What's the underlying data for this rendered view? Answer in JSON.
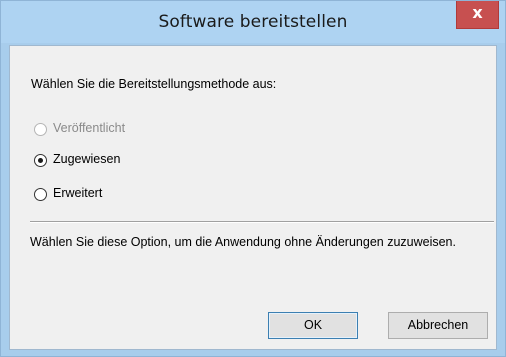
{
  "window": {
    "title": "Software bereitstellen",
    "close_glyph": "x"
  },
  "dialog": {
    "prompt": "Wählen Sie die Bereitstellungsmethode aus:",
    "options": [
      {
        "label": "Veröffentlicht",
        "selected": false,
        "enabled": false
      },
      {
        "label": "Zugewiesen",
        "selected": true,
        "enabled": true
      },
      {
        "label": "Erweitert",
        "selected": false,
        "enabled": true
      }
    ],
    "description": "Wählen Sie diese Option, um die Anwendung ohne Änderungen zuzuweisen."
  },
  "buttons": {
    "ok": "OK",
    "cancel": "Abbrechen"
  },
  "colors": {
    "titlebar": "#aed3f2",
    "close_button": "#c75050",
    "client_background": "#f0f0f0"
  }
}
